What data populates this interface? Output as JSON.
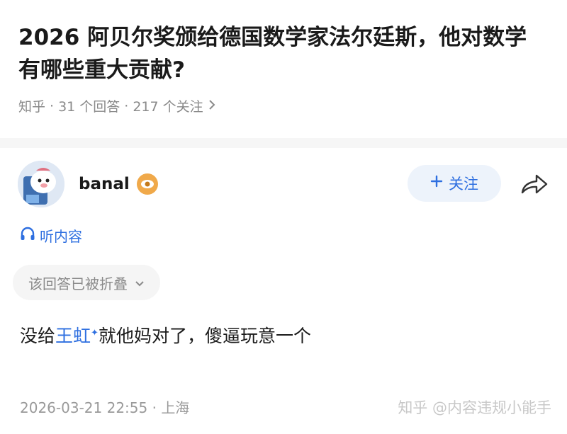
{
  "question": {
    "title": "2026 阿贝尔奖颁给德国数学家法尔廷斯，他对数学有哪些重大贡献?",
    "source": "知乎",
    "answers": "31 个回答",
    "followers": "217 个关注",
    "dot": "·"
  },
  "author": {
    "name": "banal",
    "follow_label": "关注"
  },
  "listen_label": "听内容",
  "folded_label": "该回答已被折叠",
  "answer": {
    "before": "没给",
    "link": "王虹",
    "after": "就他妈对了，傻逼玩意一个"
  },
  "footer": {
    "date": "2026-03-21 22:55",
    "location": "上海"
  },
  "watermark": "知乎 @内容违规小能手",
  "colors": {
    "accent": "#2e6fe0",
    "badge": "#f0a94a"
  }
}
